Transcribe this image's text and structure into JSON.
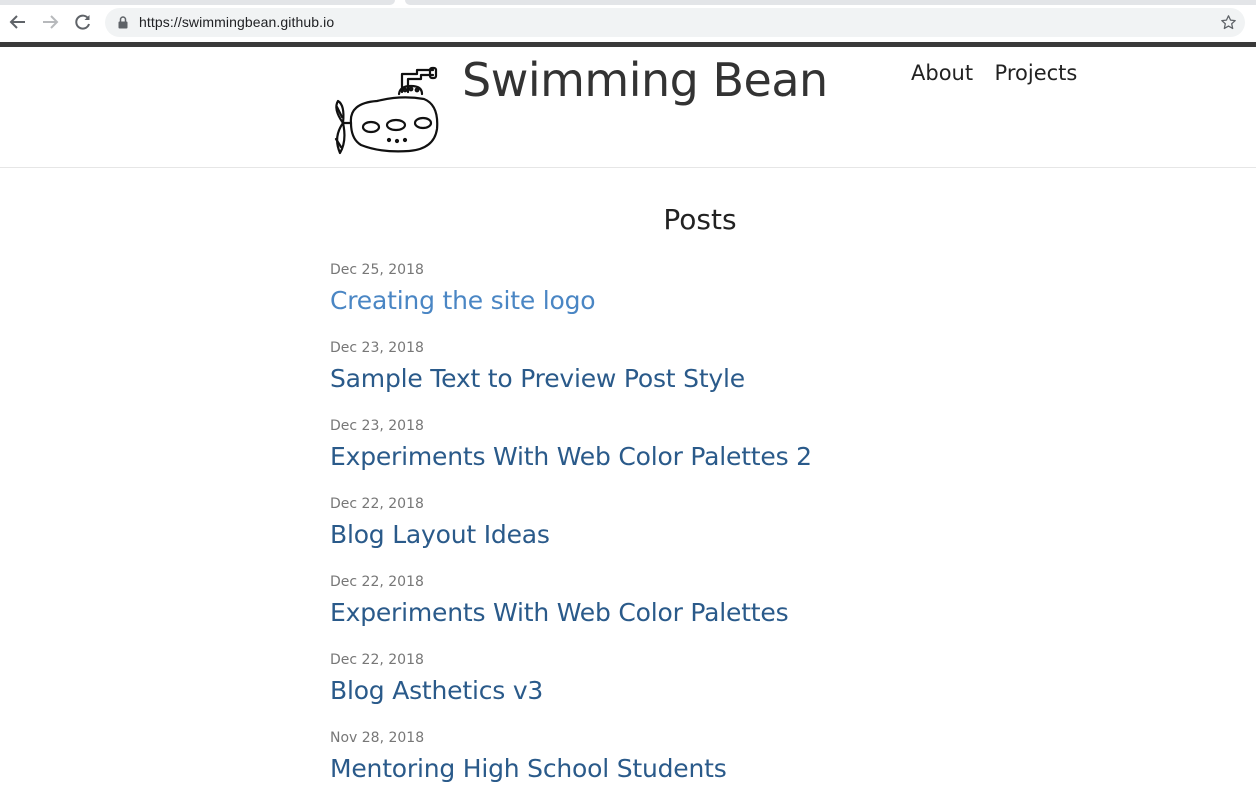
{
  "browser": {
    "url": "https://swimmingbean.github.io"
  },
  "site": {
    "title": "Swimming Bean",
    "nav": [
      {
        "label": "About"
      },
      {
        "label": "Projects"
      }
    ]
  },
  "posts": {
    "heading": "Posts",
    "items": [
      {
        "date": "Dec 25, 2018",
        "title": "Creating the site logo"
      },
      {
        "date": "Dec 23, 2018",
        "title": "Sample Text to Preview Post Style"
      },
      {
        "date": "Dec 23, 2018",
        "title": "Experiments With Web Color Palettes 2"
      },
      {
        "date": "Dec 22, 2018",
        "title": "Blog Layout Ideas"
      },
      {
        "date": "Dec 22, 2018",
        "title": "Experiments With Web Color Palettes"
      },
      {
        "date": "Dec 22, 2018",
        "title": "Blog Asthetics v3"
      },
      {
        "date": "Nov 28, 2018",
        "title": "Mentoring High School Students"
      }
    ]
  },
  "colors": {
    "link": "#2a5a8a",
    "link_hover": "#4a86c4",
    "header_bar": "#3a3a3a"
  }
}
